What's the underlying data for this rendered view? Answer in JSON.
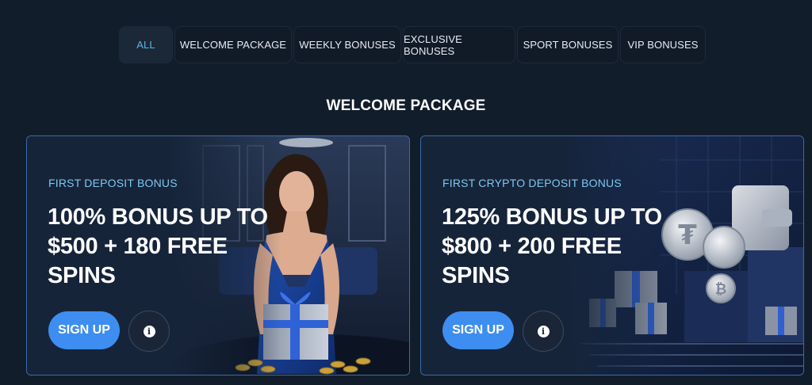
{
  "tabs": [
    {
      "label": "ALL",
      "active": true
    },
    {
      "label": "WELCOME PACKAGE",
      "active": false
    },
    {
      "label": "WEEKLY BONUSES",
      "active": false
    },
    {
      "label": "EXCLUSIVE BONUSES",
      "active": false
    },
    {
      "label": "SPORT BONUSES",
      "active": false
    },
    {
      "label": "VIP BONUSES",
      "active": false
    }
  ],
  "section_title": "WELCOME PACKAGE",
  "cards": [
    {
      "eyebrow": "FIRST DEPOSIT BONUS",
      "headline": "100% BONUS UP TO $500 + 180 FREE SPINS",
      "signup_label": "SIGN UP",
      "info_icon": "info-icon",
      "image": "woman-holding-gift-box-casino"
    },
    {
      "eyebrow": "FIRST CRYPTO DEPOSIT BONUS",
      "headline": "125% BONUS UP TO $800 + 200 FREE SPINS",
      "signup_label": "SIGN UP",
      "info_icon": "info-icon",
      "image": "crypto-coins-wallet-gifts"
    }
  ],
  "colors": {
    "background": "#121d2b",
    "accent_blue": "#3d8ef0",
    "active_tab_text": "#5fb3e6",
    "eyebrow_text": "#7ec8f0",
    "card_border": "#3c6aa8"
  }
}
